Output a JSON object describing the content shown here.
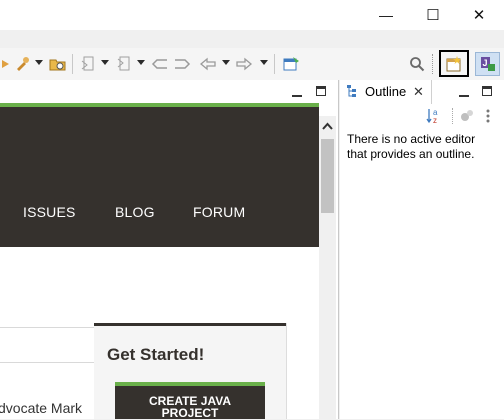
{
  "window": {
    "minimize_glyph": "—",
    "maximize_glyph": "☐",
    "close_glyph": "✕"
  },
  "toolbar": {
    "icons": [
      "run-last-tool-icon",
      "external-tools-icon",
      "open-type-icon",
      "next-annotation-icon",
      "previous-annotation-icon",
      "last-edit-location-icon",
      "back-icon",
      "forward-icon",
      "pin-editor-icon",
      "search-icon",
      "open-perspective-icon",
      "java-perspective-icon"
    ]
  },
  "editor": {
    "nav": {
      "issues": "ISSUES",
      "blog": "BLOG",
      "forum": "FORUM"
    },
    "partial_text": "dvocate Mark",
    "card": {
      "title": "Get Started!",
      "button": "CREATE JAVA PROJECT"
    },
    "colors": {
      "dark": "#35312d",
      "accent": "#6ab04a"
    }
  },
  "outline": {
    "tab_label": "Outline",
    "message": "There is no active editor that provides an outline."
  }
}
